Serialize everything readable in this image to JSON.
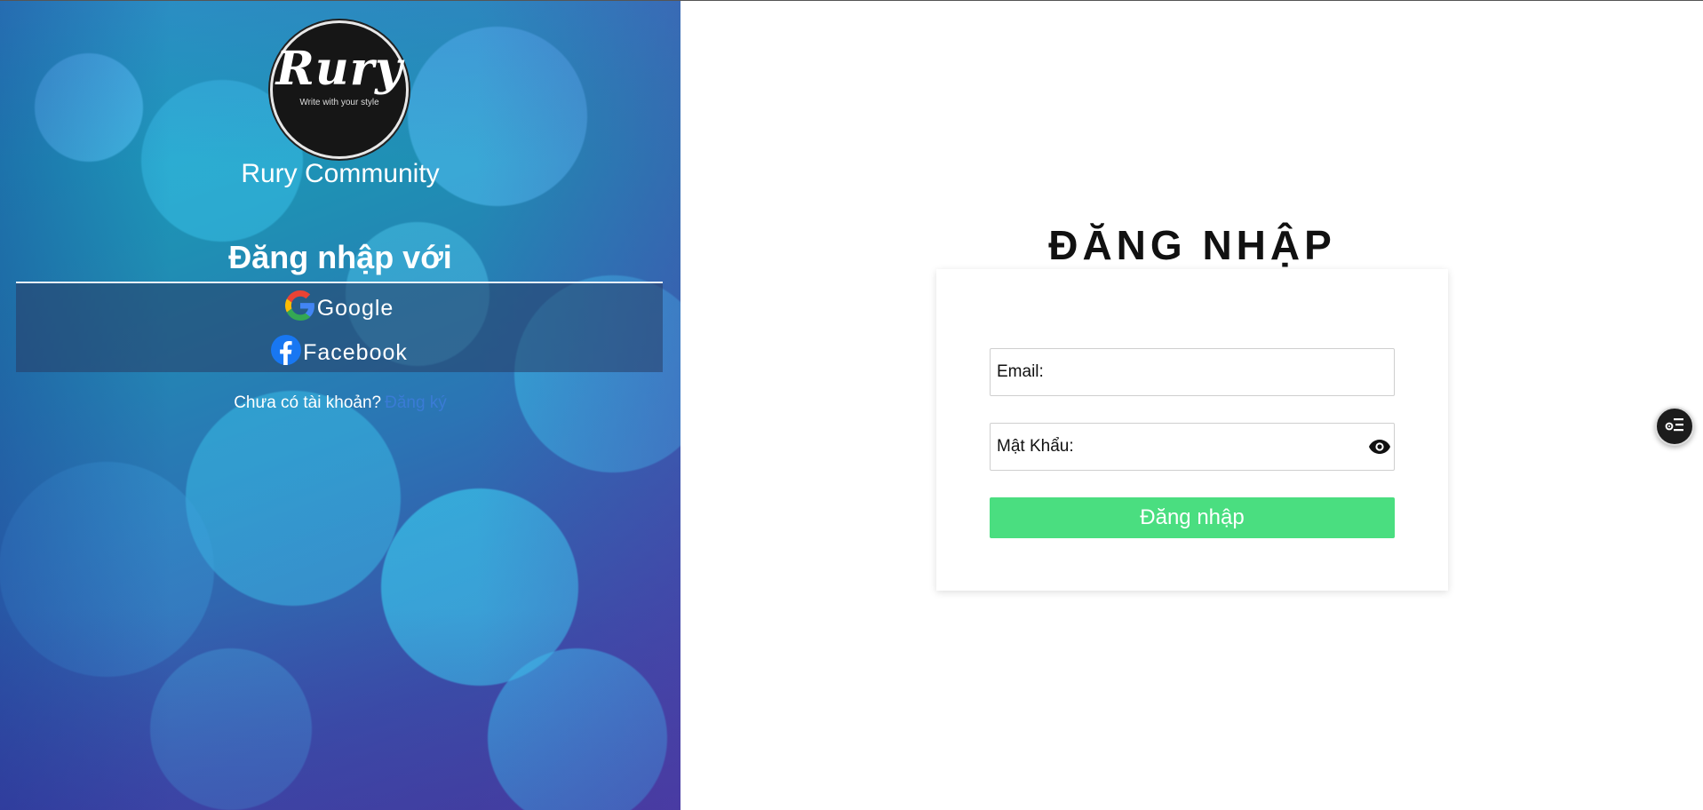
{
  "brand": {
    "logo_title": "Rury",
    "logo_tagline": "Write with your style",
    "community_name": "Rury Community"
  },
  "social_login": {
    "heading": "Đăng nhập với",
    "google_label": "Google",
    "facebook_label": "Facebook",
    "google_icon": "google-icon",
    "facebook_icon": "facebook-icon"
  },
  "signup": {
    "prompt": "Chưa có tài khoản?",
    "link_label": "Đăng ký"
  },
  "login_form": {
    "title": "ĐĂNG NHẬP",
    "email_label": "Email:",
    "email_value": "",
    "password_label": "Mật Khẩu:",
    "password_value": "",
    "submit_label": "Đăng nhập"
  },
  "colors": {
    "submit_button": "#4ade80",
    "signup_link": "#3a7bd5",
    "floating_button": "#1c1c1c"
  },
  "floating_action": {
    "icon": "settings-list-icon"
  }
}
